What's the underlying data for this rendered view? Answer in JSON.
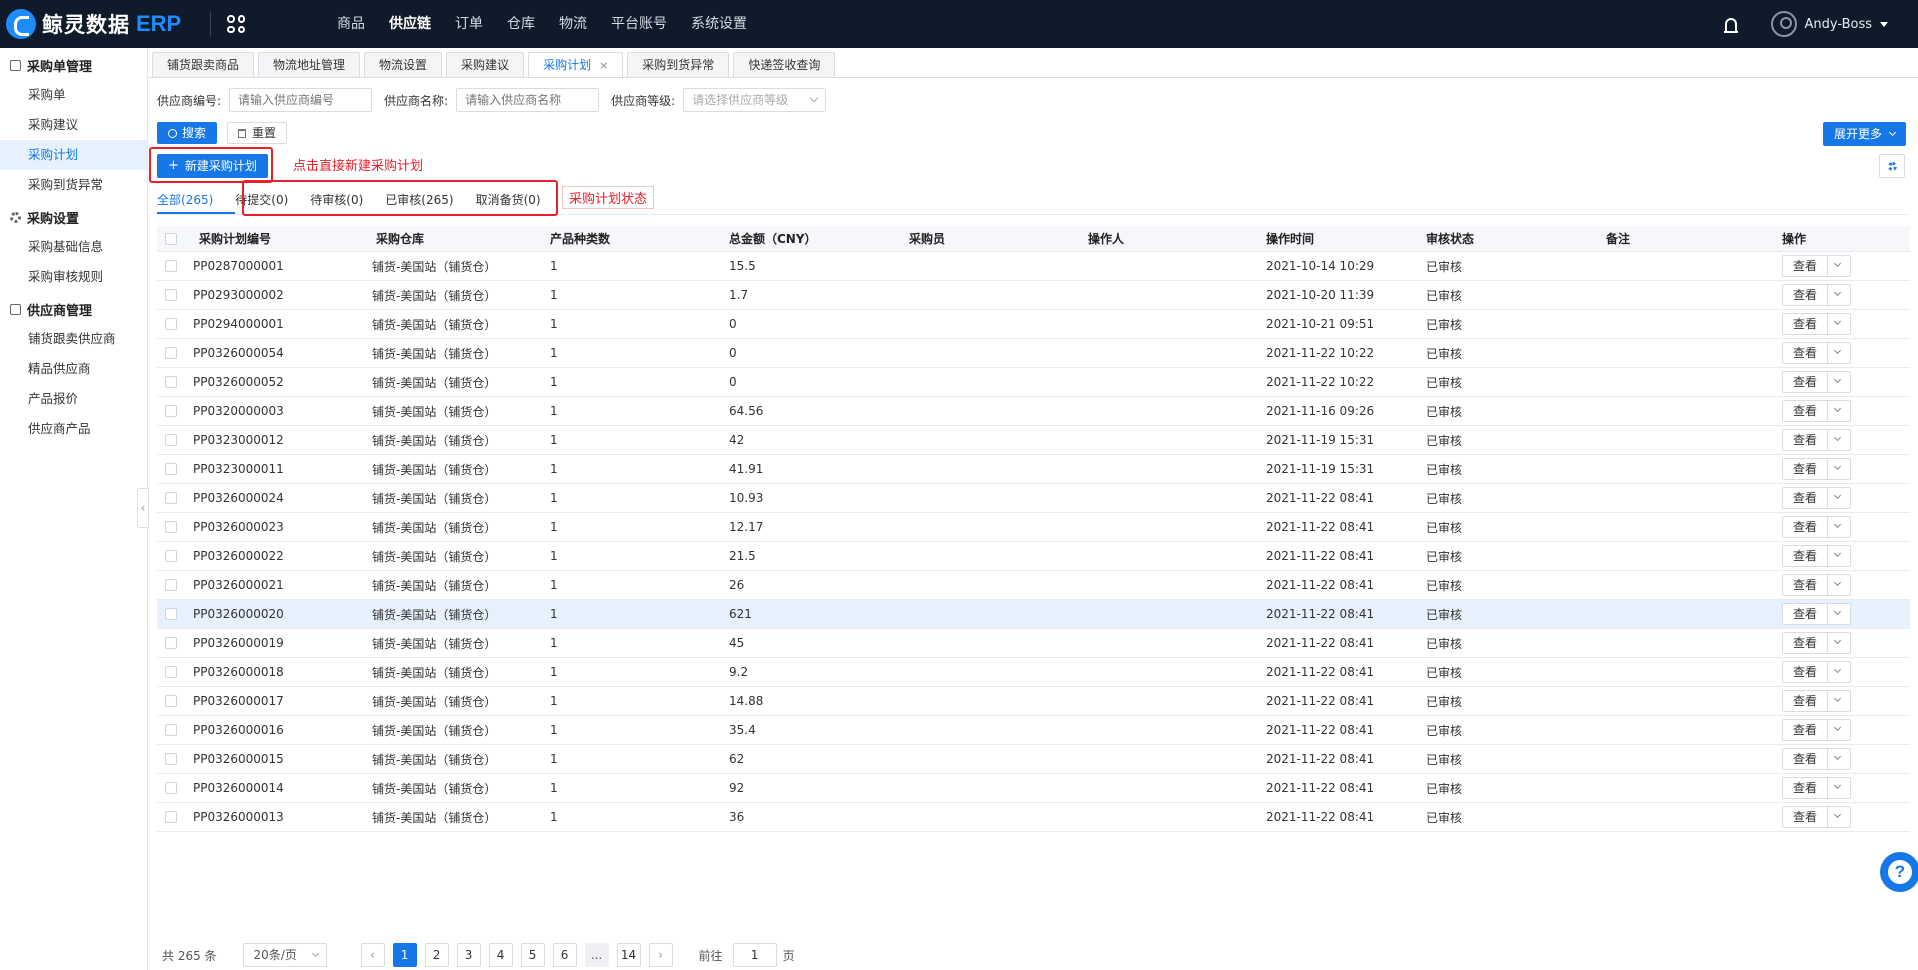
{
  "app": {
    "brand": "鲸灵数据",
    "erp": "ERP",
    "user": "Andy-Boss"
  },
  "topnav": [
    "商品",
    "供应链",
    "订单",
    "仓库",
    "物流",
    "平台账号",
    "系统设置"
  ],
  "topnav_active": "供应链",
  "sidebar": {
    "groups": [
      {
        "label": "采购单管理",
        "items": [
          "采购单",
          "采购建议",
          "采购计划",
          "采购到货异常"
        ]
      },
      {
        "label": "采购设置",
        "items": [
          "采购基础信息",
          "采购审核规则"
        ]
      },
      {
        "label": "供应商管理",
        "items": [
          "铺货跟卖供应商",
          "精品供应商",
          "产品报价",
          "供应商产品"
        ]
      }
    ],
    "active_item": "采购计划"
  },
  "tabs": [
    "铺货跟卖商品",
    "物流地址管理",
    "物流设置",
    "采购建议",
    "采购计划",
    "采购到货异常",
    "快递签收查询"
  ],
  "tabs_active": "采购计划",
  "filters": {
    "supplier_code_label": "供应商编号:",
    "supplier_code_placeholder": "请输入供应商编号",
    "supplier_name_label": "供应商名称:",
    "supplier_name_placeholder": "请输入供应商名称",
    "supplier_level_label": "供应商等级:",
    "supplier_level_placeholder": "请选择供应商等级"
  },
  "buttons": {
    "search": "搜索",
    "reset": "重置",
    "expand": "展开更多",
    "new_plan": "新建采购计划"
  },
  "annotations": {
    "new_hint": "点击直接新建采购计划",
    "status_hint": "采购计划状态"
  },
  "status_tabs": [
    "全部(265)",
    "待提交(0)",
    "待审核(0)",
    "已审核(265)",
    "取消备货(0)"
  ],
  "table": {
    "columns": [
      "采购计划编号",
      "采购仓库",
      "产品种类数",
      "总金额（CNY）",
      "采购员",
      "操作人",
      "操作时间",
      "审核状态",
      "备注",
      "操作"
    ],
    "view_label": "查看",
    "rows": [
      [
        "PP0287000001",
        "铺货-美国站（铺货仓）",
        "1",
        "15.5",
        "",
        "",
        "2021-10-14 10:29",
        "已审核",
        ""
      ],
      [
        "PP0293000002",
        "铺货-美国站（铺货仓）",
        "1",
        "1.7",
        "",
        "",
        "2021-10-20 11:39",
        "已审核",
        ""
      ],
      [
        "PP0294000001",
        "铺货-美国站（铺货仓）",
        "1",
        "0",
        "",
        "",
        "2021-10-21 09:51",
        "已审核",
        ""
      ],
      [
        "PP0326000054",
        "铺货-美国站（铺货仓）",
        "1",
        "0",
        "",
        "",
        "2021-11-22 10:22",
        "已审核",
        ""
      ],
      [
        "PP0326000052",
        "铺货-美国站（铺货仓）",
        "1",
        "0",
        "",
        "",
        "2021-11-22 10:22",
        "已审核",
        ""
      ],
      [
        "PP0320000003",
        "铺货-美国站（铺货仓）",
        "1",
        "64.56",
        "",
        "",
        "2021-11-16 09:26",
        "已审核",
        ""
      ],
      [
        "PP0323000012",
        "铺货-美国站（铺货仓）",
        "1",
        "42",
        "",
        "",
        "2021-11-19 15:31",
        "已审核",
        ""
      ],
      [
        "PP0323000011",
        "铺货-美国站（铺货仓）",
        "1",
        "41.91",
        "",
        "",
        "2021-11-19 15:31",
        "已审核",
        ""
      ],
      [
        "PP0326000024",
        "铺货-美国站（铺货仓）",
        "1",
        "10.93",
        "",
        "",
        "2021-11-22 08:41",
        "已审核",
        ""
      ],
      [
        "PP0326000023",
        "铺货-美国站（铺货仓）",
        "1",
        "12.17",
        "",
        "",
        "2021-11-22 08:41",
        "已审核",
        ""
      ],
      [
        "PP0326000022",
        "铺货-美国站（铺货仓）",
        "1",
        "21.5",
        "",
        "",
        "2021-11-22 08:41",
        "已审核",
        ""
      ],
      [
        "PP0326000021",
        "铺货-美国站（铺货仓）",
        "1",
        "26",
        "",
        "",
        "2021-11-22 08:41",
        "已审核",
        ""
      ],
      [
        "PP0326000020",
        "铺货-美国站（铺货仓）",
        "1",
        "621",
        "",
        "",
        "2021-11-22 08:41",
        "已审核",
        ""
      ],
      [
        "PP0326000019",
        "铺货-美国站（铺货仓）",
        "1",
        "45",
        "",
        "",
        "2021-11-22 08:41",
        "已审核",
        ""
      ],
      [
        "PP0326000018",
        "铺货-美国站（铺货仓）",
        "1",
        "9.2",
        "",
        "",
        "2021-11-22 08:41",
        "已审核",
        ""
      ],
      [
        "PP0326000017",
        "铺货-美国站（铺货仓）",
        "1",
        "14.88",
        "",
        "",
        "2021-11-22 08:41",
        "已审核",
        ""
      ],
      [
        "PP0326000016",
        "铺货-美国站（铺货仓）",
        "1",
        "35.4",
        "",
        "",
        "2021-11-22 08:41",
        "已审核",
        ""
      ],
      [
        "PP0326000015",
        "铺货-美国站（铺货仓）",
        "1",
        "62",
        "",
        "",
        "2021-11-22 08:41",
        "已审核",
        ""
      ],
      [
        "PP0326000014",
        "铺货-美国站（铺货仓）",
        "1",
        "92",
        "",
        "",
        "2021-11-22 08:41",
        "已审核",
        ""
      ],
      [
        "PP0326000013",
        "铺货-美国站（铺货仓）",
        "1",
        "36",
        "",
        "",
        "2021-11-22 08:41",
        "已审核",
        ""
      ]
    ],
    "highlighted_row": 12
  },
  "pagination": {
    "total": "共 265 条",
    "page_size": "20条/页",
    "pages": [
      "1",
      "2",
      "3",
      "4",
      "5",
      "6",
      "...",
      "14"
    ],
    "current": "1",
    "goto_label": "前往",
    "goto_value": "1",
    "page_suffix": "页"
  },
  "colors": {
    "primary": "#1677e6",
    "topbar": "#0f1a2a",
    "annotation": "#e8202a",
    "row_highlight": "#e6f1fd"
  }
}
